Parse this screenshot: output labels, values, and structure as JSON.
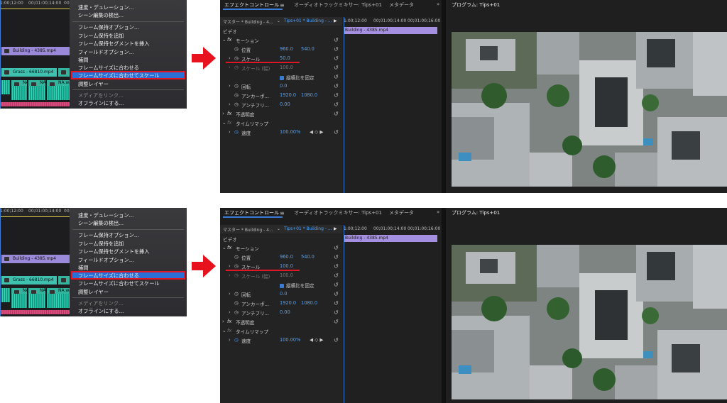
{
  "panels": [
    {
      "timeline": {
        "ruler": [
          "1:00;12:00",
          "00;01:00;14:00",
          "00;01:00;1"
        ],
        "video_clip": "Building - 4385.mp4",
        "audio_clip": "Grass - 66810.mp4",
        "audio_labels": [
          "NA",
          "NA",
          "NA.wav"
        ]
      },
      "menu": {
        "items": [
          "速度・デュレーション...",
          "シーン編集の検出...",
          "フレーム保持オプション...",
          "フレーム保持を追加",
          "フレーム保持セグメントを挿入",
          "フィールドオプション...",
          "補間",
          "フレームサイズに合わせる",
          "フレームサイズに合わせてスケール",
          "調整レイヤー",
          "メディアをリンク...",
          "オフラインにする..."
        ],
        "highlighted_index": 8
      },
      "effect_controls": {
        "tabs": [
          "エフェクトコントロール",
          "オーディオトラックミキサー: Tips+01",
          "メタデータ"
        ],
        "source": "マスター * Building - 4...",
        "sequence": "Tips+01 * Building - ...",
        "timeline_ruler": [
          "1:00;12:00",
          "00;01:00;14:00",
          "00;01:00;16:00"
        ],
        "timeline_clip": "Building - 4385.mp4",
        "video_header": "ビデオ",
        "motion": "モーション",
        "position_label": "位置",
        "position_x": "960.0",
        "position_y": "540.0",
        "scale_label": "スケール",
        "scale_value": "50.0",
        "scale_width_label": "スケール (幅)",
        "scale_width_value": "100.0",
        "uniform_scale": "縦横比を固定",
        "rotation_label": "回転",
        "rotation_value": "0.0",
        "anchor_label": "アンカーポ...",
        "anchor_x": "1920.0",
        "anchor_y": "1080.0",
        "antiflicker_label": "アンチフリ...",
        "antiflicker_value": "0.00",
        "opacity": "不透明度",
        "time_remap": "タイムリマップ",
        "speed_label": "速度",
        "speed_value": "100.00%"
      },
      "program": {
        "title": "プログラム: Tips+01"
      }
    },
    {
      "timeline": {
        "ruler": [
          "1:00;12:00",
          "00;01:00;14:00",
          "00;01:00;1"
        ],
        "video_clip": "Building - 4385.mp4",
        "audio_clip": "Grass - 66810.mp4",
        "audio_labels": [
          "NA",
          "NA",
          "NA.wav"
        ]
      },
      "menu": {
        "items": [
          "速度・デュレーション...",
          "シーン編集の検出...",
          "フレーム保持オプション...",
          "フレーム保持を追加",
          "フレーム保持セグメントを挿入",
          "フィールドオプション...",
          "補間",
          "フレームサイズに合わせる",
          "フレームサイズに合わせてスケール",
          "調整レイヤー",
          "メディアをリンク...",
          "オフラインにする..."
        ],
        "highlighted_index": 7
      },
      "effect_controls": {
        "tabs": [
          "エフェクトコントロール",
          "オーディオトラックミキサー: Tips+01",
          "メタデータ"
        ],
        "source": "マスター * Building - 4...",
        "sequence": "Tips+01 * Building - ...",
        "timeline_ruler": [
          "1:00;12:00",
          "00;01:00;14:00",
          "00;01:00;16:00"
        ],
        "timeline_clip": "Building - 4385.mp4",
        "video_header": "ビデオ",
        "motion": "モーション",
        "position_label": "位置",
        "position_x": "960.0",
        "position_y": "540.0",
        "scale_label": "スケール",
        "scale_value": "100.0",
        "scale_width_label": "スケール (幅)",
        "scale_width_value": "100.0",
        "uniform_scale": "縦横比を固定",
        "rotation_label": "回転",
        "rotation_value": "0.0",
        "anchor_label": "アンカーポ...",
        "anchor_x": "1920.0",
        "anchor_y": "1080.0",
        "antiflicker_label": "アンチフリ...",
        "antiflicker_value": "0.00",
        "opacity": "不透明度",
        "time_remap": "タイムリマップ",
        "speed_label": "速度",
        "speed_value": "100.00%"
      },
      "program": {
        "title": "プログラム: Tips+01"
      }
    }
  ],
  "colors": {
    "highlight_border": "#e01525",
    "menu_highlight": "#2a6fd6",
    "arrow": "#e8121e",
    "value_blue": "#4da3ff",
    "clip_purple": "#9a88d9"
  }
}
